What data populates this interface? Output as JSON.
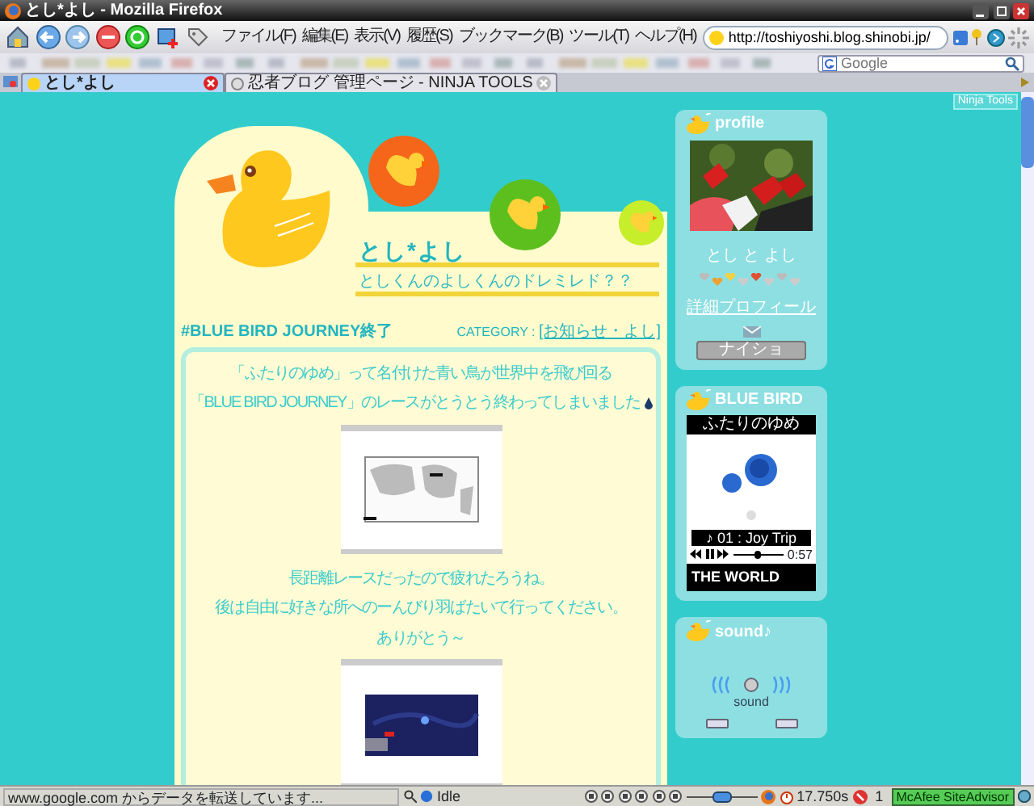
{
  "window": {
    "title": "とし*よし - Mozilla Firefox"
  },
  "menu": [
    {
      "label": "ファイル(F)"
    },
    {
      "label": "編集(E)"
    },
    {
      "label": "表示(V)"
    },
    {
      "label": "履歴(S)"
    },
    {
      "label": "ブックマーク(B)"
    },
    {
      "label": "ツール(T)"
    },
    {
      "label": "ヘルプ(H)"
    }
  ],
  "address_bar": {
    "value": "http://toshiyoshi.blog.shinobi.jp/"
  },
  "search": {
    "placeholder": "Google"
  },
  "tabs": [
    {
      "label": "とし*よし",
      "selected": true
    },
    {
      "label": "忍者ブログ 管理ページ - NINJA TOOLS",
      "selected": false
    }
  ],
  "page": {
    "ninja_tools": "Ninja Tools",
    "blog_title": "とし*よし",
    "blog_subtitle": "としくんのよしくんのドレミレド？？",
    "post": {
      "title": "#BLUE BIRD JOURNEY終了",
      "category_label": "CATEGORY : ",
      "category": "[お知らせ・よし]",
      "body": [
        {
          "kind": "text",
          "text": "「ふたりのゆめ」って名付けた青い鳥が世界中を飛び回る"
        },
        {
          "kind": "text-icon",
          "text": "「BLUE BIRD JOURNEY」のレースがとうとう終わってしまいました"
        },
        {
          "kind": "picture"
        },
        {
          "kind": "text",
          "text": "長距離レースだったので疲れたろうね。"
        },
        {
          "kind": "text",
          "text": "後は自由に好きな所へのーんびり羽ばたいて行ってください。"
        },
        {
          "kind": "text",
          "text": "ありがとう～"
        },
        {
          "kind": "picture"
        }
      ]
    },
    "sidebar": [
      {
        "kind": "profile",
        "title": "profile",
        "name": "とし と よし",
        "link": "詳細プロフィール",
        "button": "ナイショ"
      },
      {
        "kind": "player",
        "title": "BLUE BIRD",
        "header": "ふたりのゆめ",
        "track": "♪ 01 : Joy Trip",
        "level": 0.48,
        "time": "0:57",
        "footer": "THE WORLD"
      },
      {
        "kind": "sound",
        "title": "sound♪",
        "label": "sound"
      }
    ]
  },
  "status_bar": {
    "text": "www.google.com からデータを転送しています...",
    "player_state": "Idle",
    "volume": {
      "level": 0.5
    },
    "timer": "17.750s",
    "count": "1",
    "advisor": "McAfee SiteAdvisor"
  }
}
